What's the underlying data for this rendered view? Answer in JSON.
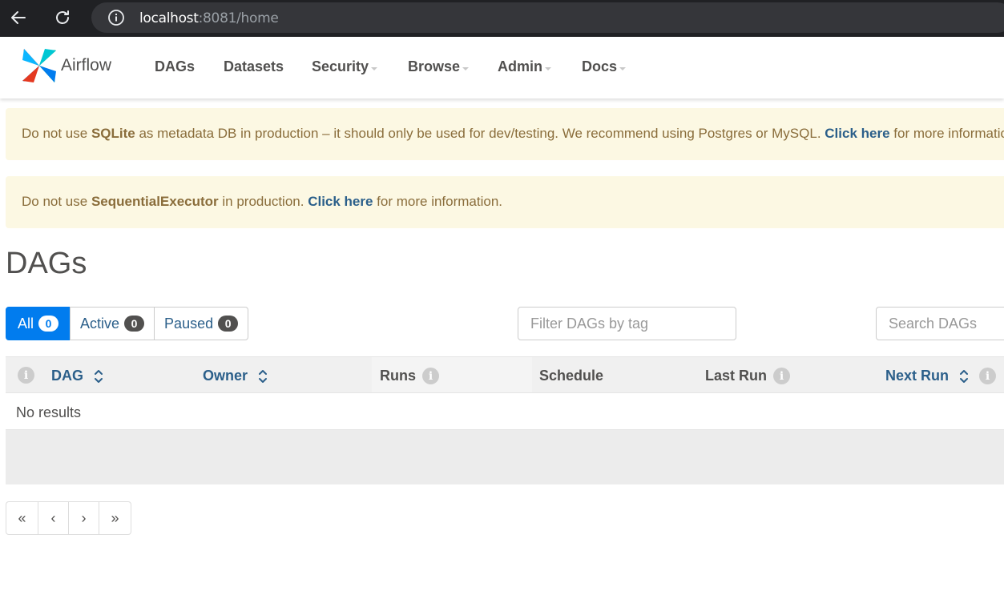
{
  "browser": {
    "url_host": "localhost",
    "url_rest": ":8081/home"
  },
  "navbar": {
    "brand": "Airflow",
    "items": [
      {
        "label": "DAGs",
        "dropdown": false
      },
      {
        "label": "Datasets",
        "dropdown": false
      },
      {
        "label": "Security",
        "dropdown": true
      },
      {
        "label": "Browse",
        "dropdown": true
      },
      {
        "label": "Admin",
        "dropdown": true
      },
      {
        "label": "Docs",
        "dropdown": true
      }
    ]
  },
  "alerts": {
    "sqlite": {
      "prefix": "Do not use ",
      "bold": "SQLite",
      "middle": " as metadata DB in production – it should only be used for dev/testing. We recommend using Postgres or MySQL. ",
      "link": "Click here",
      "suffix": " for more information."
    },
    "executor": {
      "prefix": "Do not use ",
      "bold": "SequentialExecutor",
      "middle": " in production. ",
      "link": "Click here",
      "suffix": " for more information."
    }
  },
  "page_title": "DAGs",
  "filters": {
    "all": {
      "label": "All",
      "count": "0"
    },
    "active": {
      "label": "Active",
      "count": "0"
    },
    "paused": {
      "label": "Paused",
      "count": "0"
    }
  },
  "tag_filter": {
    "placeholder": "Filter DAGs by tag"
  },
  "search": {
    "placeholder": "Search DAGs"
  },
  "table": {
    "columns": {
      "dag": "DAG",
      "owner": "Owner",
      "runs": "Runs",
      "schedule": "Schedule",
      "last_run": "Last Run",
      "next_run": "Next Run"
    },
    "empty_text": "No results"
  },
  "pagination": {
    "first": "«",
    "prev": "‹",
    "next": "›",
    "last": "»"
  },
  "colors": {
    "primary": "#017cee",
    "link": "#2b5f8a",
    "warning_bg": "#fcf8e3",
    "warning_text": "#8a6d3b"
  }
}
